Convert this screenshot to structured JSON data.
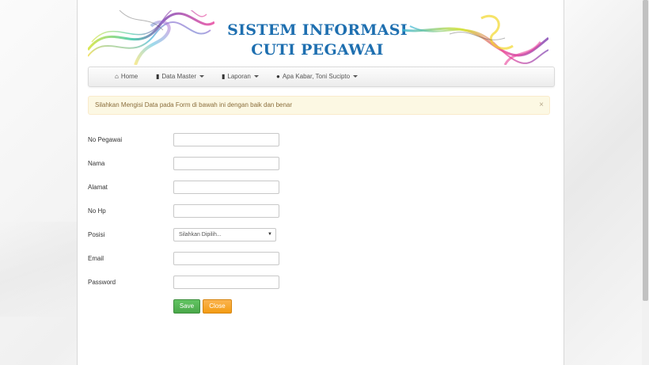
{
  "banner": {
    "title_line1": "SISTEM INFORMASI",
    "title_line2": "CUTI PEGAWAI"
  },
  "nav": {
    "items": [
      {
        "label": "Home",
        "icon": "home-icon"
      },
      {
        "label": "Data Master",
        "icon": "book-icon"
      },
      {
        "label": "Laporan",
        "icon": "book-icon"
      },
      {
        "label": "Apa Kabar, Toni Sucipto",
        "icon": "globe-icon"
      }
    ]
  },
  "alert": {
    "message": "Silahkan Mengisi Data pada Form di bawah ini dengan baik dan benar",
    "close": "×"
  },
  "form": {
    "fields": [
      {
        "label": "No Pegawai",
        "value": ""
      },
      {
        "label": "Nama",
        "value": ""
      },
      {
        "label": "Alamat",
        "value": ""
      },
      {
        "label": "No Hp",
        "value": ""
      },
      {
        "label": "Posisi",
        "value": "Silahkan Dipilih..."
      },
      {
        "label": "Email",
        "value": ""
      },
      {
        "label": "Password",
        "value": ""
      }
    ],
    "save_label": "Save",
    "close_label": "Close"
  }
}
